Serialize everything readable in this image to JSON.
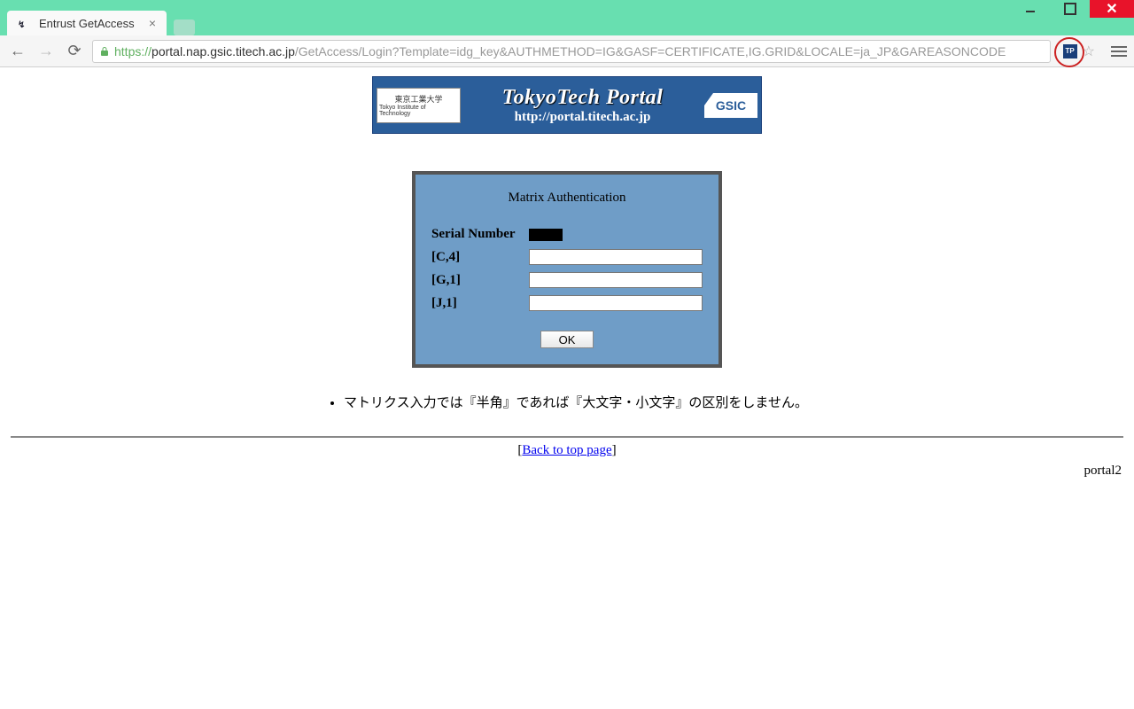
{
  "window": {
    "tab_title": "Entrust GetAccess",
    "min_tip": "Minimize",
    "max_tip": "Maximize",
    "close_label": "✕"
  },
  "addr": {
    "protocol": "https://",
    "host": "portal.nap.gsic.titech.ac.jp",
    "path": "/GetAccess/Login?Template=idg_key&AUTHMETHOD=IG&GASF=CERTIFICATE,IG.GRID&LOCALE=ja_JP&GAREASONCODE",
    "ext_label": "TP"
  },
  "banner": {
    "left_top": "東京工業大学",
    "left_bottom": "Tokyo Institute of Technology",
    "title": "TokyoTech Portal",
    "url": "http://portal.titech.ac.jp",
    "right": "GSIC"
  },
  "auth": {
    "title": "Matrix Authentication",
    "serial_label": "Serial Number",
    "rows": [
      {
        "label": "[C,4]"
      },
      {
        "label": "[G,1]"
      },
      {
        "label": "[J,1]"
      }
    ],
    "ok_label": "OK"
  },
  "note": "マトリクス入力では『半角』であれば『大文字・小文字』の区別をしません。",
  "back": {
    "open": "[",
    "text": "Back to top page",
    "close": "]"
  },
  "footer": "portal2"
}
